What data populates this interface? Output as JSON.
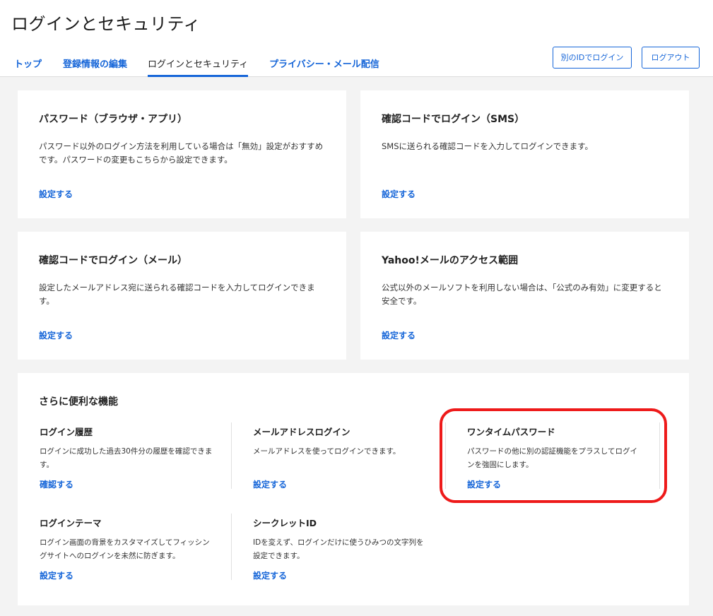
{
  "header": {
    "title": "ログインとセキュリティ",
    "tabs": [
      {
        "label": "トップ"
      },
      {
        "label": "登録情報の編集"
      },
      {
        "label": "ログインとセキュリティ"
      },
      {
        "label": "プライバシー・メール配信"
      }
    ],
    "switch_id_label": "別のIDでログイン",
    "logout_label": "ログアウト"
  },
  "cards": [
    {
      "title": "パスワード（ブラウザ・アプリ）",
      "desc": "パスワード以外のログイン方法を利用している場合は「無効」設定がおすすめです。パスワードの変更もこちらから設定できます。",
      "link": "設定する"
    },
    {
      "title": "確認コードでログイン（SMS）",
      "desc": "SMSに送られる確認コードを入力してログインできます。",
      "link": "設定する"
    },
    {
      "title": "確認コードでログイン（メール）",
      "desc": "設定したメールアドレス宛に送られる確認コードを入力してログインできます。",
      "link": "設定する"
    },
    {
      "title": "Yahoo!メールのアクセス範囲",
      "desc": "公式以外のメールソフトを利用しない場合は、「公式のみ有効」に変更すると安全です。",
      "link": "設定する"
    }
  ],
  "more": {
    "title": "さらに便利な機能",
    "features": [
      {
        "title": "ログイン履歴",
        "desc": "ログインに成功した過去30件分の履歴を確認できます。",
        "link": "確認する"
      },
      {
        "title": "メールアドレスログイン",
        "desc": "メールアドレスを使ってログインできます。",
        "link": "設定する"
      },
      {
        "title": "ワンタイムパスワード",
        "desc": "パスワードの他に別の認証機能をプラスしてログインを強固にします。",
        "link": "設定する"
      },
      {
        "title": "ログインテーマ",
        "desc": "ログイン画面の背景をカスタマイズしてフィッシングサイトへのログインを未然に防ぎます。",
        "link": "設定する"
      },
      {
        "title": "シークレットID",
        "desc": "IDを変えず、ログインだけに使うひみつの文字列を設定できます。",
        "link": "設定する"
      }
    ]
  },
  "colors": {
    "link": "#1565d8",
    "highlight": "#ee1a1a",
    "background": "#f3f3f3"
  }
}
